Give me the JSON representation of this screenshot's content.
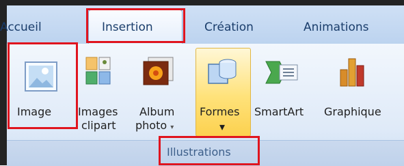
{
  "tabs": [
    {
      "label": "Accueil",
      "selected": false
    },
    {
      "label": "Insertion",
      "selected": true
    },
    {
      "label": "Création",
      "selected": false
    },
    {
      "label": "Animations",
      "selected": false
    }
  ],
  "group": {
    "label": "Illustrations"
  },
  "buttons": {
    "image": "Image",
    "images_clipart_1": "Images",
    "images_clipart_2": "clipart",
    "album_1": "Album",
    "album_2": "photo",
    "formes": "Formes",
    "smartart": "SmartArt",
    "graphique": "Graphique"
  },
  "dropdown_arrow": "▾",
  "colors": {
    "highlight_box": "#e0141e",
    "hover_fill": "#ffe27a"
  }
}
